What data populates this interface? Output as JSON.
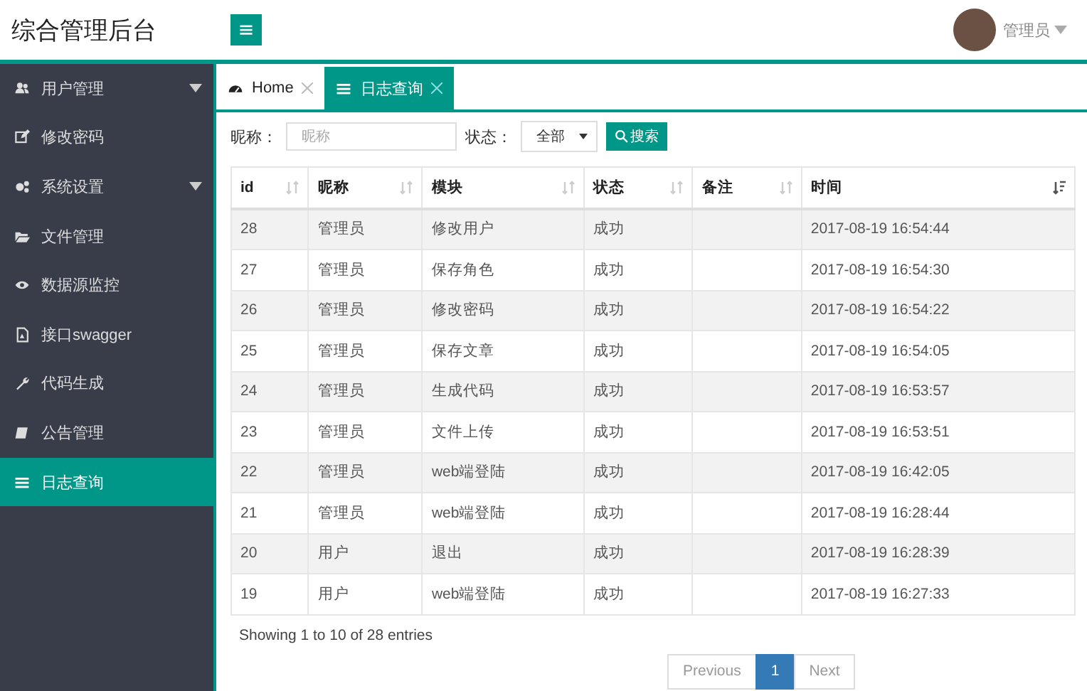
{
  "header": {
    "title": "综合管理后台",
    "user": {
      "name": "管理员"
    }
  },
  "sidebar": {
    "items": [
      {
        "label": "用户管理",
        "has_submenu": true,
        "selected": false
      },
      {
        "label": "修改密码",
        "has_submenu": false,
        "selected": false
      },
      {
        "label": "系统设置",
        "has_submenu": true,
        "selected": false
      },
      {
        "label": "文件管理",
        "has_submenu": false,
        "selected": false
      },
      {
        "label": "数据源监控",
        "has_submenu": false,
        "selected": false
      },
      {
        "label": "接口swagger",
        "has_submenu": false,
        "selected": false
      },
      {
        "label": "代码生成",
        "has_submenu": false,
        "selected": false
      },
      {
        "label": "公告管理",
        "has_submenu": false,
        "selected": false
      },
      {
        "label": "日志查询",
        "has_submenu": false,
        "selected": true
      }
    ]
  },
  "tabs": [
    {
      "label": "Home",
      "selected": false
    },
    {
      "label": "日志查询",
      "selected": true
    }
  ],
  "search": {
    "nickname_label": "昵称：",
    "nickname": {
      "placeholder": "昵称"
    },
    "status_label": "状态：",
    "status_value": "全部",
    "button": "搜索"
  },
  "table": {
    "columns": [
      {
        "label": "id",
        "sorted": false
      },
      {
        "label": "昵称",
        "sorted": false
      },
      {
        "label": "模块",
        "sorted": false
      },
      {
        "label": "状态",
        "sorted": false
      },
      {
        "label": "备注",
        "sorted": false
      },
      {
        "label": "时间",
        "sorted": true
      }
    ],
    "rows": [
      [
        "28",
        "管理员",
        "修改用户",
        "成功",
        "",
        "2017-08-19 16:54:44"
      ],
      [
        "27",
        "管理员",
        "保存角色",
        "成功",
        "",
        "2017-08-19 16:54:30"
      ],
      [
        "26",
        "管理员",
        "修改密码",
        "成功",
        "",
        "2017-08-19 16:54:22"
      ],
      [
        "25",
        "管理员",
        "保存文章",
        "成功",
        "",
        "2017-08-19 16:54:05"
      ],
      [
        "24",
        "管理员",
        "生成代码",
        "成功",
        "",
        "2017-08-19 16:53:57"
      ],
      [
        "23",
        "管理员",
        "文件上传",
        "成功",
        "",
        "2017-08-19 16:53:51"
      ],
      [
        "22",
        "管理员",
        "web端登陆",
        "成功",
        "",
        "2017-08-19 16:42:05"
      ],
      [
        "21",
        "管理员",
        "web端登陆",
        "成功",
        "",
        "2017-08-19 16:28:44"
      ],
      [
        "20",
        "用户",
        "退出",
        "成功",
        "",
        "2017-08-19 16:28:39"
      ],
      [
        "19",
        "用户",
        "web端登陆",
        "成功",
        "",
        "2017-08-19 16:27:33"
      ]
    ]
  },
  "footer": {
    "info": "Showing 1 to 10 of 28 entries",
    "pages": [
      {
        "label": "Previous",
        "selected": false
      },
      {
        "label": "1",
        "selected": true
      },
      {
        "label": "Next",
        "selected": false
      }
    ]
  }
}
